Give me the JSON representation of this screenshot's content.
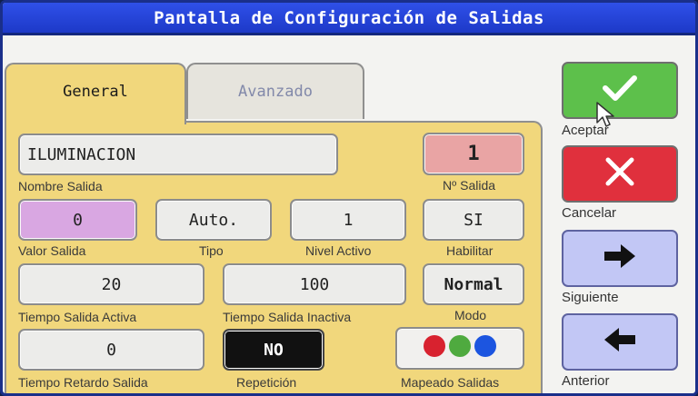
{
  "window": {
    "title": "Pantalla de Configuración de Salidas"
  },
  "tabs": [
    {
      "label": "General",
      "active": true
    },
    {
      "label": "Avanzado",
      "active": false
    }
  ],
  "fields": {
    "nombre_salida": {
      "value": "ILUMINACION",
      "label": "Nombre Salida"
    },
    "num_salida": {
      "value": "1",
      "label": "Nº Salida"
    },
    "valor_salida": {
      "value": "0",
      "label": "Valor Salida"
    },
    "tipo": {
      "value": "Auto.",
      "label": "Tipo"
    },
    "nivel_activo": {
      "value": "1",
      "label": "Nivel Activo"
    },
    "habilitar": {
      "value": "SI",
      "label": "Habilitar"
    },
    "tiempo_salida_activa": {
      "value": "20",
      "label": "Tiempo Salida Activa"
    },
    "tiempo_salida_inactiva": {
      "value": "100",
      "label": "Tiempo Salida Inactiva"
    },
    "modo": {
      "value": "Normal",
      "label": "Modo"
    },
    "tiempo_retardo_salida": {
      "value": "0",
      "label": "Tiempo Retardo Salida"
    },
    "repeticion": {
      "value": "NO",
      "label": "Repetición"
    },
    "mapeado_salidas": {
      "label": "Mapeado Salidas",
      "dot_colors": [
        "#d8222f",
        "#4faa3f",
        "#1c55e0"
      ]
    }
  },
  "actions": {
    "aceptar": {
      "label": "Aceptar",
      "icon": "check-icon",
      "color": "#5dc04b"
    },
    "cancelar": {
      "label": "Cancelar",
      "icon": "close-icon",
      "color": "#e0303d"
    },
    "siguiente": {
      "label": "Siguiente",
      "icon": "arrow-right-icon",
      "color": "#c2c7f5"
    },
    "anterior": {
      "label": "Anterior",
      "icon": "arrow-left-icon",
      "color": "#c2c7f5"
    }
  },
  "colors": {
    "title_bar": "#1d39c8",
    "panel": "#f1d77c",
    "nombre_field": "#ececea",
    "num_salida_field": "#e9a4a4",
    "valor_salida_field": "#d9a7e2",
    "repeticion_field": "#111111"
  }
}
